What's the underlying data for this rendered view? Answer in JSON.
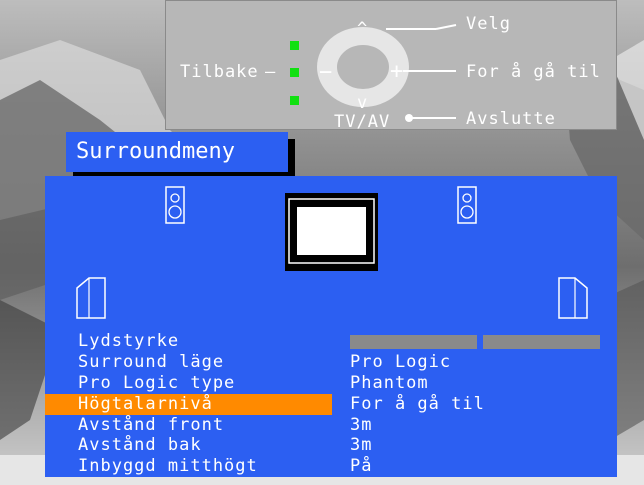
{
  "remote_help": {
    "back_label": "Tilbake",
    "select_label": "Velg",
    "continue_label": "For å gå til",
    "exit_label": "Avslutte",
    "tvav_label": "TV/AV",
    "arrow_up": "^",
    "arrow_down": "v",
    "minus": "−",
    "plus": "+"
  },
  "menu": {
    "title": "Surroundmeny",
    "rows": [
      {
        "label": "Lydstyrke",
        "value": ""
      },
      {
        "label": "Surround läge",
        "value": "Pro Logic"
      },
      {
        "label": "Pro Logic type",
        "value": "Phantom"
      },
      {
        "label": "Högtalarnivå",
        "value": "For å gå til"
      },
      {
        "label": "Avstånd front",
        "value": "3m"
      },
      {
        "label": "Avstånd bak",
        "value": "3m"
      },
      {
        "label": "Inbyggd mitthögt",
        "value": "På"
      }
    ],
    "highlighted_index": 3
  },
  "colors": {
    "menu_blue": "#2c5ff2",
    "highlight": "#ff8a00",
    "led": "#11e011"
  }
}
